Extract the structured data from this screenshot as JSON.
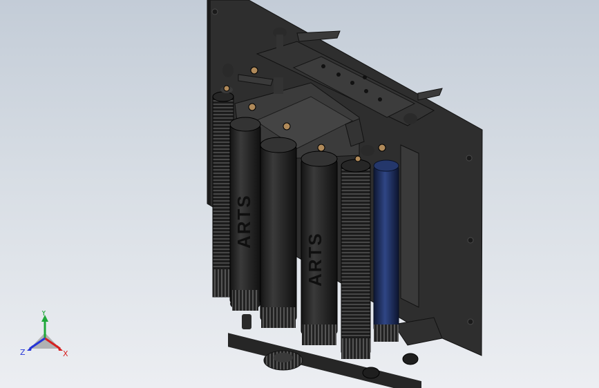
{
  "viewport": {
    "background_top": "#c3ccd7",
    "background_bottom": "#eceef2"
  },
  "model": {
    "roller_labels": [
      "ARTS",
      "ARTS"
    ],
    "part_color": "#2b2b2b",
    "highlight_roller_color": "#1e2d55",
    "fastener_color": "#b08a5a"
  },
  "triad": {
    "x_label": "X",
    "y_label": "Y",
    "z_label": "Z",
    "x_color": "#d62020",
    "y_color": "#1fa83a",
    "z_color": "#2635d8"
  }
}
